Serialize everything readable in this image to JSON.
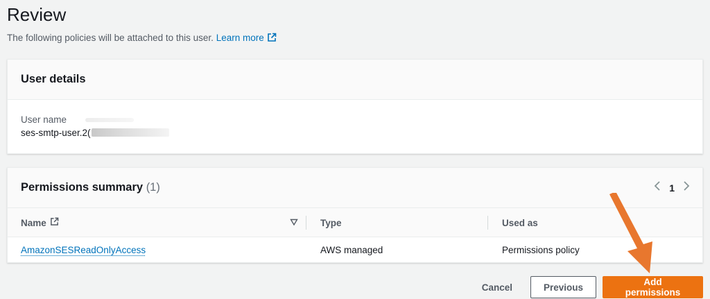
{
  "header": {
    "title": "Review",
    "subtitle": "The following policies will be attached to this user.",
    "learn_more": "Learn more"
  },
  "user_details": {
    "title": "User details",
    "field_label": "User name",
    "field_value": "ses-smtp-user.2("
  },
  "permissions": {
    "title": "Permissions summary",
    "count": "(1)",
    "page": "1",
    "columns": [
      "Name",
      "Type",
      "Used as"
    ],
    "rows": [
      {
        "name": "AmazonSESReadOnlyAccess",
        "type": "AWS managed",
        "used_as": "Permissions policy"
      }
    ]
  },
  "actions": {
    "cancel": "Cancel",
    "previous": "Previous",
    "primary": "Add permissions"
  },
  "colors": {
    "accent": "#ec7211",
    "link": "#0073bb",
    "annotation_arrow": "#e8772e"
  }
}
